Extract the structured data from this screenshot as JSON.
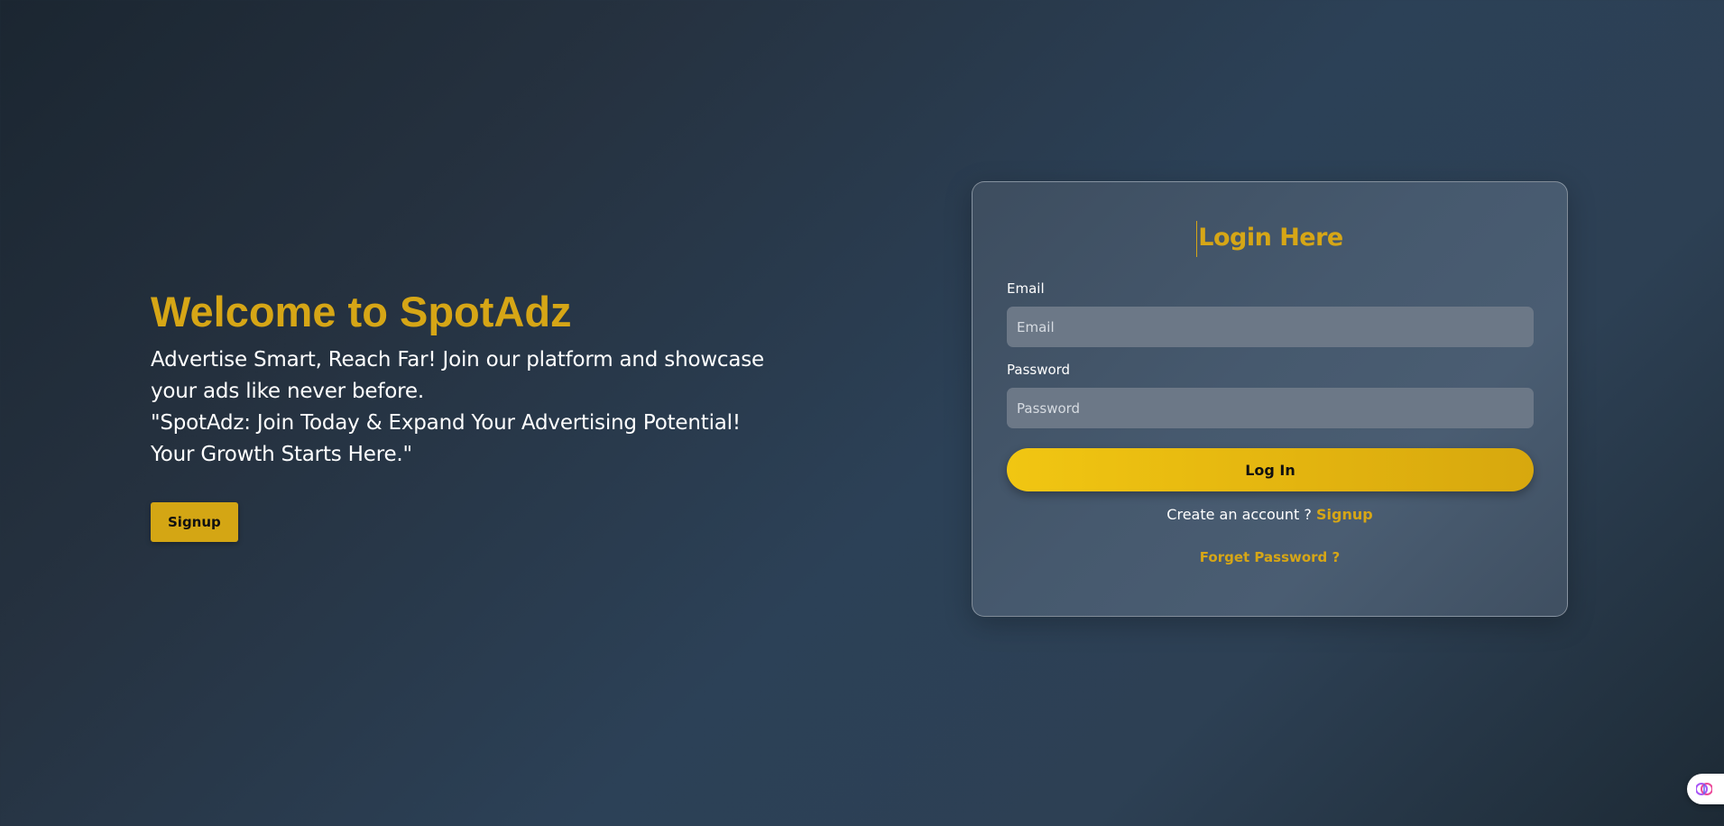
{
  "hero": {
    "title": "Welcome to SpotAdz",
    "tagline_line1": "Advertise Smart, Reach Far! Join our platform and showcase",
    "tagline_line2": "your ads like never before.",
    "tagline_line3": "\"SpotAdz: Join Today & Expand Your Advertising Potential!",
    "tagline_line4": "Your Growth Starts Here.\"",
    "signup_label": "Signup"
  },
  "login": {
    "title": "Login Here",
    "email_label": "Email",
    "email_placeholder": "Email",
    "email_value": "",
    "password_label": "Password",
    "password_placeholder": "Password",
    "password_value": "",
    "submit_label": "Log In",
    "create_prompt": "Create an account ?",
    "create_link": "Signup",
    "forget_link": "Forget Password ?"
  },
  "widget": {
    "icon": "brain-icon"
  },
  "colors": {
    "accent": "#d6a616",
    "button": "#f1c612",
    "input_bg": "#6c7887"
  }
}
